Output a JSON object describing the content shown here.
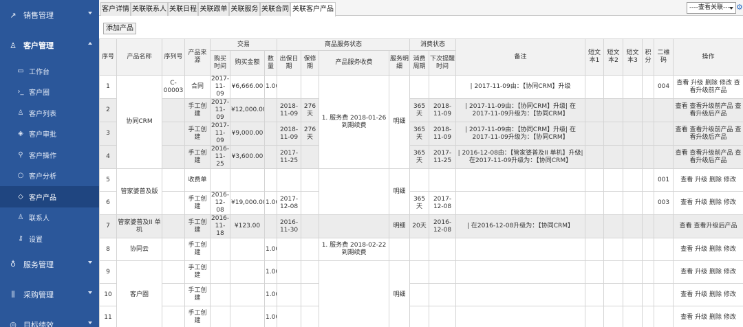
{
  "sidebar": {
    "groups": [
      {
        "icon": "trend-icon",
        "label": "销售管理"
      },
      {
        "icon": "user-icon",
        "label": "客户管理"
      }
    ],
    "sub_items": [
      {
        "icon": "monitor-icon",
        "label": "工作台"
      },
      {
        "icon": "terminal-icon",
        "label": "客户圈"
      },
      {
        "icon": "user-list-icon",
        "label": "客户列表"
      },
      {
        "icon": "tag-icon",
        "label": "客户审批"
      },
      {
        "icon": "wrench-icon",
        "label": "客户操作"
      },
      {
        "icon": "search-icon",
        "label": "客户分析"
      },
      {
        "icon": "cube-icon",
        "label": "客户产品"
      },
      {
        "icon": "contact-icon",
        "label": "联系人"
      },
      {
        "icon": "key-icon",
        "label": "设置"
      }
    ],
    "bottom_groups": [
      {
        "icon": "thumb-icon",
        "label": "服务管理"
      },
      {
        "icon": "bars-icon",
        "label": "采购管理"
      },
      {
        "icon": "target-icon",
        "label": "目标绩效"
      }
    ]
  },
  "tabs": [
    "客户详情",
    "关联联系人",
    "关联日程",
    "关联跟单",
    "关联服务",
    "关联合同",
    "关联客户产品"
  ],
  "active_tab": "关联客户产品",
  "view_select": {
    "value": "----查看关联----"
  },
  "add_button": "添加产品",
  "headers": {
    "seq": "序号",
    "product_name": "产品名称",
    "serial": "序列号",
    "source": "产品来源",
    "trade": "交易",
    "buy_time": "购买时间",
    "buy_amount": "购买金额",
    "qty": "数量",
    "service_status": "商品服务状态",
    "ship_date": "出保日期",
    "warranty": "保修期",
    "service_fee": "产品服务收费",
    "service_detail": "服务明细",
    "consume": "消费状态",
    "consume_cycle": "消费周期",
    "next_remind": "下次提醒时间",
    "note": "备注",
    "text1": "短文本1",
    "text2": "短文本2",
    "text3": "短文本3",
    "points": "积分",
    "qrcode": "二维码",
    "ops": "操作"
  },
  "rows": [
    {
      "seq": "1",
      "serial": "C-00003",
      "source": "合同",
      "buy_time": "2017-11-09",
      "amount": "¥6,666.00",
      "qty": "1.00",
      "ship": "",
      "warranty": "",
      "cycle": "",
      "remind": "",
      "note": "| 2017-11-09由：【协同CRM】升级",
      "qrcode": "004",
      "ops": "查看 升级 删除 修改 查看升级前产品"
    },
    {
      "seq": "2",
      "serial": "",
      "source": "手工创建",
      "buy_time": "2017-11-09",
      "amount": "¥12,000.00",
      "qty": "",
      "ship": "2018-11-09",
      "warranty": "276天",
      "cycle": "365天",
      "remind": "2018-11-09",
      "note": "| 2017-11-09由：【协同CRM】升级| 在2017-11-09升级为：【协同CRM】",
      "qrcode": "",
      "ops": "查看 查看升级前产品 查看升级后产品"
    },
    {
      "seq": "3",
      "serial": "",
      "source": "手工创建",
      "buy_time": "2017-11-09",
      "amount": "¥9,000.00",
      "qty": "",
      "ship": "2018-11-09",
      "warranty": "276天",
      "cycle": "365天",
      "remind": "2018-11-09",
      "note": "| 2017-11-09由：【协同CRM】升级| 在2017-11-09升级为：【协同CRM】",
      "qrcode": "",
      "ops": "查看 查看升级前产品 查看升级后产品"
    },
    {
      "seq": "4",
      "serial": "",
      "source": "手工创建",
      "buy_time": "2016-11-25",
      "amount": "¥3,600.00",
      "qty": "",
      "ship": "2017-11-25",
      "warranty": "",
      "cycle": "365天",
      "remind": "2017-11-25",
      "note": "| 2016-12-08由：【管家婆普及II 单机】升级| 在2017-11-09升级为：【协同CRM】",
      "qrcode": "",
      "ops": "查看 查看升级前产品 查看升级后产品"
    },
    {
      "seq": "5",
      "serial": "",
      "source": "收费单",
      "buy_time": "",
      "amount": "",
      "qty": "",
      "ship": "",
      "warranty": "",
      "cycle": "",
      "remind": "",
      "note": "",
      "qrcode": "001",
      "ops": "查看 升级 删除 修改"
    },
    {
      "seq": "6",
      "serial": "",
      "source": "手工创建",
      "buy_time": "2016-12-08",
      "amount": "¥19,000.00",
      "qty": "1.00",
      "ship": "2017-12-08",
      "warranty": "",
      "cycle": "365天",
      "remind": "2017-12-08",
      "note": "",
      "qrcode": "003",
      "ops": "查看 升级 删除 修改"
    },
    {
      "seq": "7",
      "serial": "",
      "source": "手工创建",
      "buy_time": "2016-11-18",
      "amount": "¥123.00",
      "qty": "",
      "ship": "2016-11-30",
      "warranty": "",
      "cycle": "20天",
      "remind": "2016-12-08",
      "note": "| 在2016-12-08升级为：【协同CRM】",
      "qrcode": "",
      "ops": "查看 查看升级后产品"
    },
    {
      "seq": "8",
      "serial": "",
      "source": "手工创建",
      "buy_time": "",
      "amount": "",
      "qty": "1.00",
      "ship": "",
      "warranty": "",
      "cycle": "",
      "remind": "",
      "note": "",
      "qrcode": "",
      "ops": "查看 升级 删除 修改"
    },
    {
      "seq": "9",
      "serial": "",
      "source": "手工创建",
      "buy_time": "",
      "amount": "",
      "qty": "1.00",
      "ship": "",
      "warranty": "",
      "cycle": "",
      "remind": "",
      "note": "",
      "qrcode": "",
      "ops": "查看 升级 删除 修改"
    },
    {
      "seq": "10",
      "serial": "",
      "source": "手工创建",
      "buy_time": "",
      "amount": "",
      "qty": "1.00",
      "ship": "",
      "warranty": "",
      "cycle": "",
      "remind": "",
      "note": "",
      "qrcode": "",
      "ops": "查看 升级 删除 修改"
    },
    {
      "seq": "11",
      "serial": "",
      "source": "手工创建",
      "buy_time": "",
      "amount": "",
      "qty": "1.00",
      "ship": "",
      "warranty": "",
      "cycle": "",
      "remind": "",
      "note": "",
      "qrcode": "",
      "ops": "查看 升级 删除 修改"
    }
  ],
  "product_groups": [
    {
      "name": "协同CRM"
    },
    {
      "name": "管家婆普及版"
    },
    {
      "name": "管家婆普及II 单机"
    },
    {
      "name": "协同云"
    },
    {
      "name": "客户圈"
    }
  ],
  "service_fees": [
    {
      "text": "1. 服务费 2018-01-26到期续费"
    },
    {
      "text": "1. 服务费 2018-02-22到期续费"
    }
  ],
  "detail_link": "明细"
}
